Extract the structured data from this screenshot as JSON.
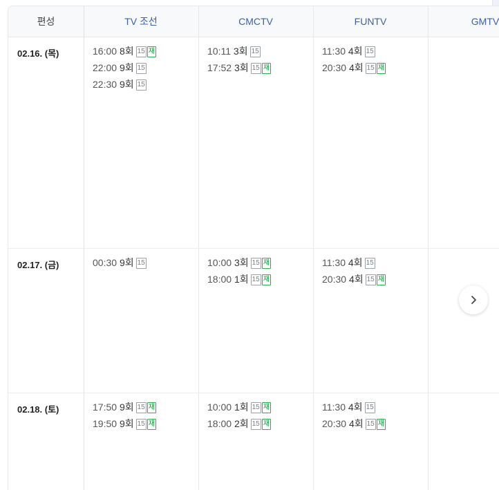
{
  "header": {
    "label": "편성",
    "channels": [
      "TV 조선",
      "CMCTV",
      "FUNTV",
      "GMTV"
    ]
  },
  "rows": [
    {
      "date": "02.16. (목)",
      "cells": [
        [
          {
            "time": "16:00",
            "ep": "8회",
            "rating": "15",
            "re": "재"
          },
          {
            "time": "22:00",
            "ep": "9회",
            "rating": "15",
            "re": ""
          },
          {
            "time": "22:30",
            "ep": "9회",
            "rating": "15",
            "re": ""
          }
        ],
        [
          {
            "time": "10:11",
            "ep": "3회",
            "rating": "15",
            "re": ""
          },
          {
            "time": "17:52",
            "ep": "3회",
            "rating": "15",
            "re": "재"
          }
        ],
        [
          {
            "time": "11:30",
            "ep": "4회",
            "rating": "15",
            "re": ""
          },
          {
            "time": "20:30",
            "ep": "4회",
            "rating": "15",
            "re": "재"
          }
        ],
        []
      ]
    },
    {
      "date": "02.17. (금)",
      "cells": [
        [
          {
            "time": "00:30",
            "ep": "9회",
            "rating": "15",
            "re": ""
          }
        ],
        [
          {
            "time": "10:00",
            "ep": "3회",
            "rating": "15",
            "re": "재"
          },
          {
            "time": "18:00",
            "ep": "1회",
            "rating": "15",
            "re": "재"
          }
        ],
        [
          {
            "time": "11:30",
            "ep": "4회",
            "rating": "15",
            "re": ""
          },
          {
            "time": "20:30",
            "ep": "4회",
            "rating": "15",
            "re": "재"
          }
        ],
        []
      ]
    },
    {
      "date": "02.18. (토)",
      "cells": [
        [
          {
            "time": "17:50",
            "ep": "9회",
            "rating": "15",
            "re": "재"
          },
          {
            "time": "19:50",
            "ep": "9회",
            "rating": "15",
            "re": "재"
          }
        ],
        [
          {
            "time": "10:00",
            "ep": "1회",
            "rating": "15",
            "re": "재"
          },
          {
            "time": "18:00",
            "ep": "2회",
            "rating": "15",
            "re": "재"
          }
        ],
        [
          {
            "time": "11:30",
            "ep": "4회",
            "rating": "15",
            "re": ""
          },
          {
            "time": "20:30",
            "ep": "4회",
            "rating": "15",
            "re": "재"
          }
        ],
        []
      ]
    }
  ],
  "next_button": {
    "icon": "chevron-right-icon"
  }
}
